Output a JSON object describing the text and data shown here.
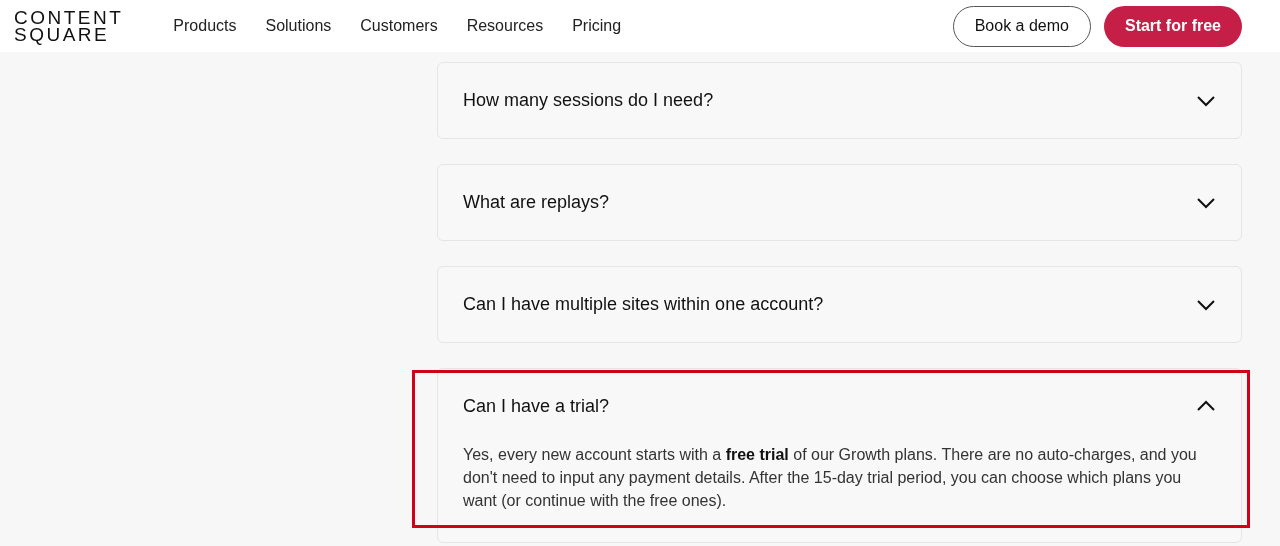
{
  "header": {
    "logo": [
      "CONTENT",
      "SQUARE"
    ],
    "nav": [
      "Products",
      "Solutions",
      "Customers",
      "Resources",
      "Pricing"
    ],
    "demo_button": "Book a demo",
    "start_button": "Start for free"
  },
  "faqs": [
    {
      "question": "How many sessions do I need?",
      "expanded": false,
      "highlighted": false
    },
    {
      "question": "What are replays?",
      "expanded": false,
      "highlighted": false
    },
    {
      "question": "Can I have multiple sites within one account?",
      "expanded": false,
      "highlighted": false
    },
    {
      "question": "Can I have a trial?",
      "expanded": true,
      "highlighted": true,
      "answer": "Yes, every new account starts with a **free trial** of our Growth plans. There are no auto-charges, and you don't need to input any payment details. After the 15-day trial period, you can choose which plans you want (or continue with the free ones)."
    }
  ]
}
